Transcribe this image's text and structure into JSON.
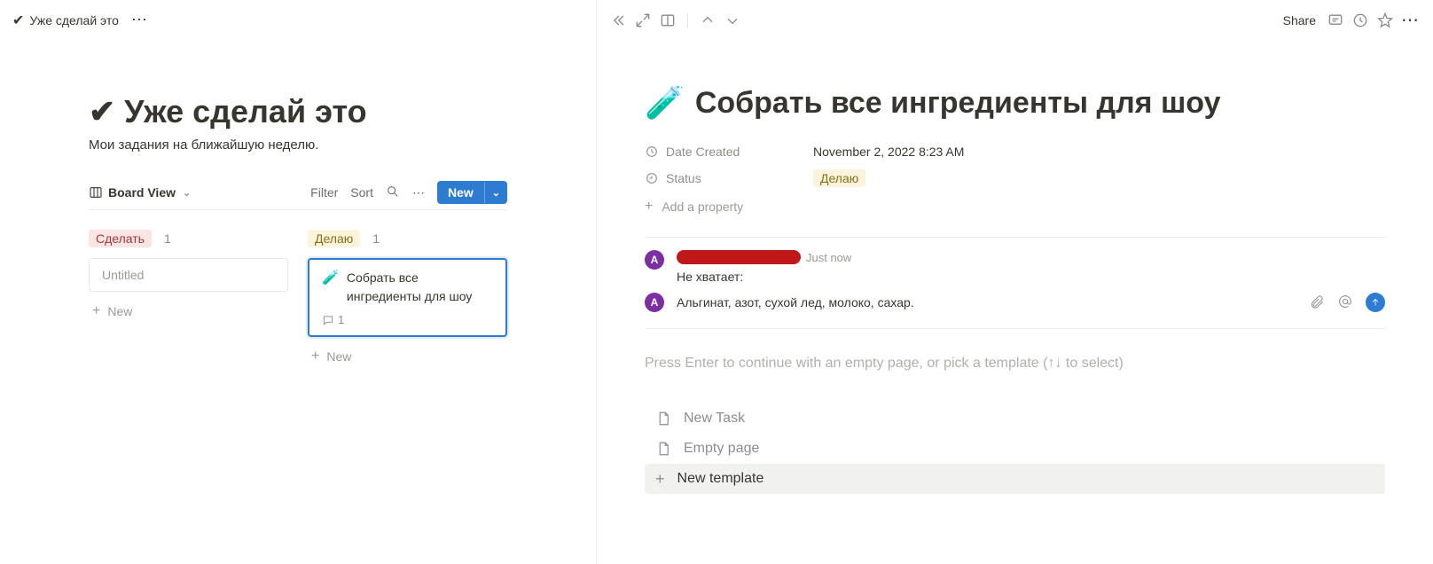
{
  "breadcrumb": {
    "title": "Уже сделай это"
  },
  "page": {
    "title": "Уже сделай это",
    "subtitle": "Мои задания на ближайшую неделю."
  },
  "viewbar": {
    "view_name": "Board View",
    "filter": "Filter",
    "sort": "Sort",
    "new": "New"
  },
  "board": {
    "columns": [
      {
        "label": "Сделать",
        "color": "red",
        "count": "1",
        "cards": [
          {
            "title": "Untitled",
            "untitled": true
          }
        ],
        "new_label": "New"
      },
      {
        "label": "Делаю",
        "color": "yellow",
        "count": "1",
        "cards": [
          {
            "emoji": "🧪",
            "title": "Собрать все ингредиенты для шоу",
            "selected": true,
            "comment_count": "1"
          }
        ],
        "new_label": "New"
      }
    ]
  },
  "detail": {
    "share": "Share",
    "emoji": "🧪",
    "title": "Собрать все ингредиенты для шоу",
    "props": {
      "date_created_label": "Date Created",
      "date_created_value": "November 2, 2022 8:23 AM",
      "status_label": "Status",
      "status_value": "Делаю",
      "add_property": "Add a property"
    },
    "comments": {
      "avatar_initial": "A",
      "time": "Just now",
      "text": "Не хватает:",
      "input_avatar": "A",
      "input_text": "Альгинат, азот, сухой лед, молоко, сахар."
    },
    "template_hint": "Press Enter to continue with an empty page, or pick a template (↑↓ to select)",
    "templates": {
      "new_task": "New Task",
      "empty_page": "Empty page",
      "new_template": "New template"
    }
  }
}
